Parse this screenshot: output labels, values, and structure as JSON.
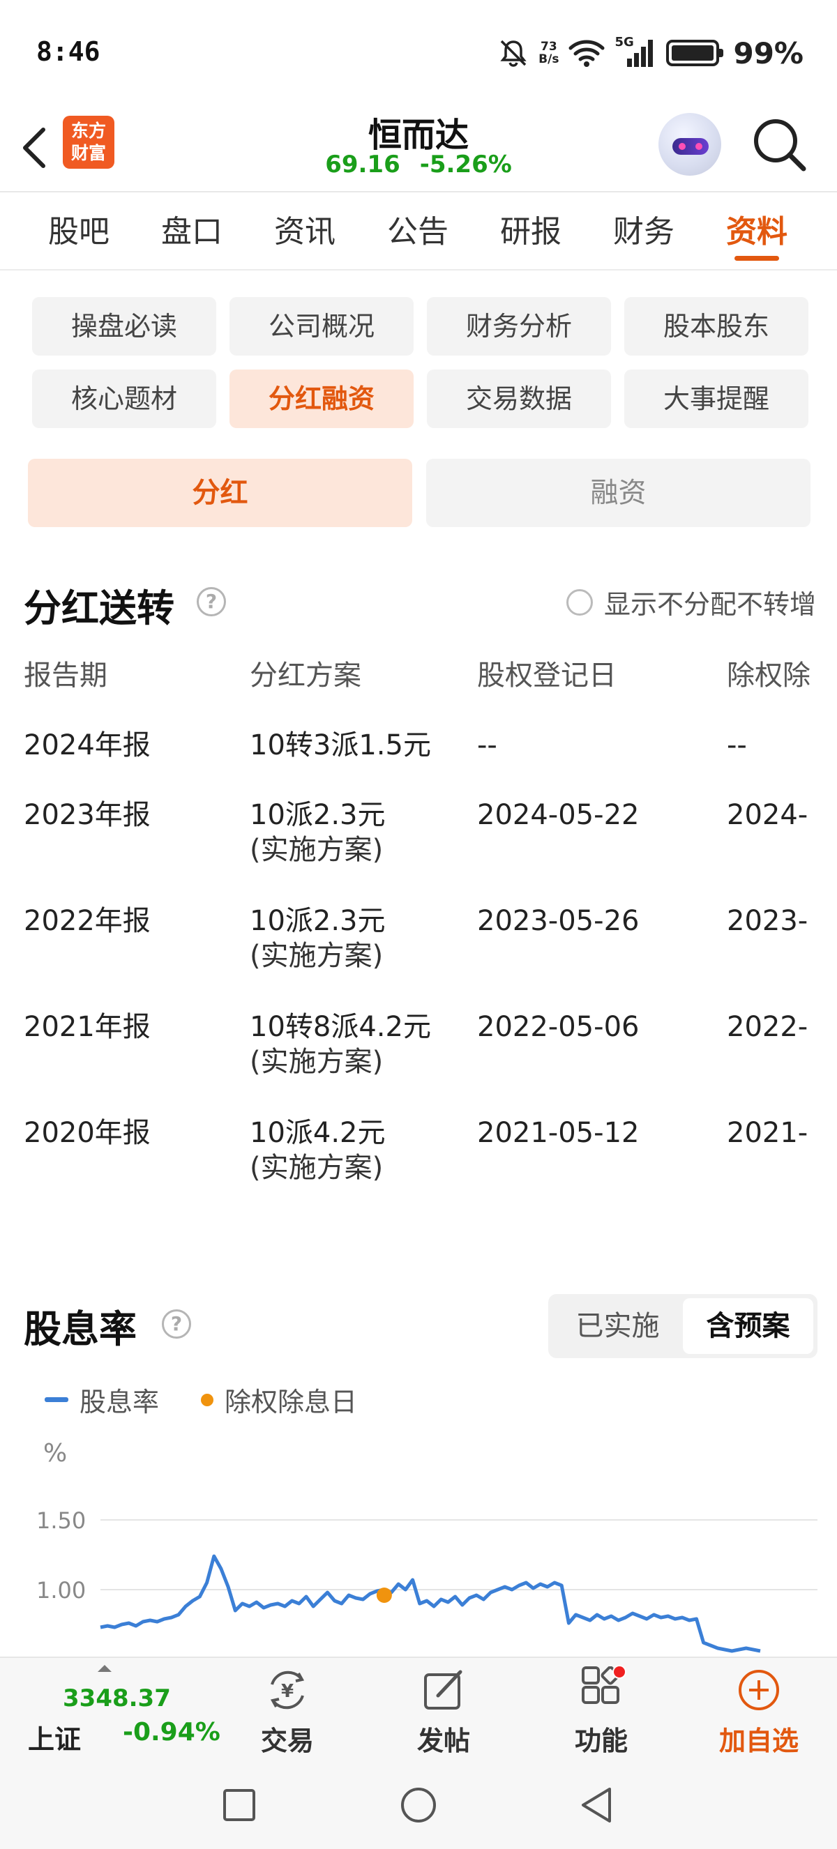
{
  "status_bar": {
    "time": "8:46",
    "net_speed_top": "73",
    "net_speed_bottom": "B/s",
    "network": "5G",
    "battery": "99%"
  },
  "header": {
    "logo_text": "东方财富",
    "stock_name": "恒而达",
    "price": "69.16",
    "change_pct": "-5.26%"
  },
  "main_tabs": [
    {
      "label": "股吧",
      "active": false
    },
    {
      "label": "盘口",
      "active": false
    },
    {
      "label": "资讯",
      "active": false
    },
    {
      "label": "公告",
      "active": false
    },
    {
      "label": "研报",
      "active": false
    },
    {
      "label": "财务",
      "active": false
    },
    {
      "label": "资料",
      "active": true
    }
  ],
  "sub_tabs": [
    {
      "label": "操盘必读",
      "active": false
    },
    {
      "label": "公司概况",
      "active": false
    },
    {
      "label": "财务分析",
      "active": false
    },
    {
      "label": "股本股东",
      "active": false
    },
    {
      "label": "核心题材",
      "active": false
    },
    {
      "label": "分红融资",
      "active": true
    },
    {
      "label": "交易数据",
      "active": false
    },
    {
      "label": "大事提醒",
      "active": false
    }
  ],
  "segment": {
    "left": "分红",
    "right": "融资"
  },
  "dividend": {
    "title": "分红送转",
    "help": "?",
    "toggle_label": "显示不分配不转增",
    "columns": [
      "报告期",
      "分红方案",
      "股权登记日",
      "除权除"
    ],
    "rows": [
      {
        "period": "2024年报",
        "plan": "10转3派1.5元",
        "note": "",
        "record_date": "--",
        "ex_date": "--"
      },
      {
        "period": "2023年报",
        "plan": "10派2.3元",
        "note": "(实施方案)",
        "record_date": "2024-05-22",
        "ex_date": "2024-"
      },
      {
        "period": "2022年报",
        "plan": "10派2.3元",
        "note": "(实施方案)",
        "record_date": "2023-05-26",
        "ex_date": "2023-"
      },
      {
        "period": "2021年报",
        "plan": "10转8派4.2元",
        "note": "(实施方案)",
        "record_date": "2022-05-06",
        "ex_date": "2022-"
      },
      {
        "period": "2020年报",
        "plan": "10派4.2元",
        "note": "(实施方案)",
        "record_date": "2021-05-12",
        "ex_date": "2021-"
      }
    ]
  },
  "yield": {
    "title": "股息率",
    "help": "?",
    "toggle": [
      "已实施",
      "含预案"
    ],
    "toggle_active": 1,
    "legend_line": "股息率",
    "legend_dot": "除权除息日",
    "colors": {
      "line": "#3b7fd6",
      "dot": "#f0930e"
    }
  },
  "chart_data": {
    "type": "line",
    "title": "",
    "xlabel": "",
    "ylabel": "%",
    "ylim": [
      0.6,
      1.5
    ],
    "y_ticks": [
      "1.50",
      "1.00"
    ],
    "series": [
      {
        "name": "股息率",
        "values": [
          0.73,
          0.74,
          0.73,
          0.75,
          0.76,
          0.74,
          0.77,
          0.78,
          0.77,
          0.79,
          0.8,
          0.82,
          0.88,
          0.92,
          0.95,
          1.05,
          1.24,
          1.15,
          1.02,
          0.85,
          0.9,
          0.88,
          0.91,
          0.87,
          0.89,
          0.9,
          0.88,
          0.92,
          0.9,
          0.95,
          0.88,
          0.93,
          0.98,
          0.92,
          0.9,
          0.96,
          0.94,
          0.93,
          0.97,
          0.99,
          1.0,
          0.98,
          1.04,
          1.0,
          1.07,
          0.9,
          0.92,
          0.88,
          0.93,
          0.91,
          0.95,
          0.89,
          0.94,
          0.96,
          0.93,
          0.98,
          1.0,
          1.02,
          1.0,
          1.03,
          1.05,
          1.01,
          1.04,
          1.02,
          1.05,
          1.03,
          0.76,
          0.82,
          0.8,
          0.78,
          0.82,
          0.79,
          0.81,
          0.78,
          0.8,
          0.83,
          0.81,
          0.79,
          0.82,
          0.8,
          0.81,
          0.79,
          0.8,
          0.78,
          0.79,
          0.62,
          0.6,
          0.58,
          0.57,
          0.56,
          0.57,
          0.58,
          0.57,
          0.56
        ]
      }
    ],
    "ex_dividend_points": [
      {
        "index": 40,
        "value": 0.96
      }
    ],
    "grid": true
  },
  "bottom_nav": {
    "index": {
      "value": "3348.37",
      "name": "上证",
      "pct": "-0.94%"
    },
    "items": [
      {
        "label": "交易",
        "icon": "trade-icon"
      },
      {
        "label": "发帖",
        "icon": "post-icon"
      },
      {
        "label": "功能",
        "icon": "apps-icon"
      },
      {
        "label": "加自选",
        "icon": "add-watchlist-icon"
      }
    ]
  }
}
